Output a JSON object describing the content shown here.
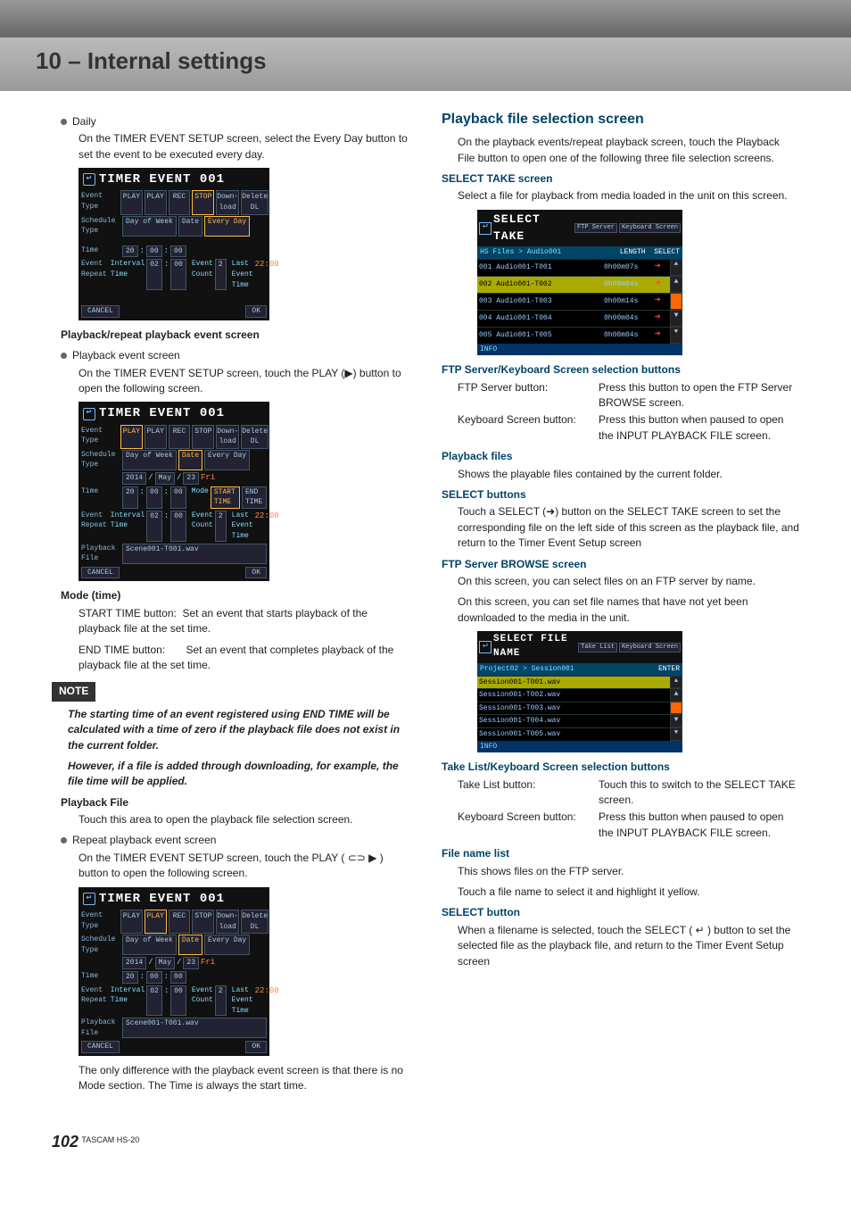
{
  "page": {
    "number": "102",
    "model": "TASCAM HS-20"
  },
  "title": "10 – Internal settings",
  "left": {
    "daily": {
      "label": "Daily",
      "body": "On the TIMER EVENT SETUP screen, select the Every Day button to set the event to be executed every day."
    },
    "playback_head": "Playback/repeat playback event screen",
    "playback_event": {
      "label": "Playback event screen",
      "body": "On the TIMER EVENT SETUP screen, touch the PLAY (▶) button to open the following screen."
    },
    "mode_time": {
      "title": "Mode (time)",
      "row1a": "START TIME button:",
      "row1b": "Set an event that starts playback of the playback file at the set time.",
      "row2a": "END TIME button:",
      "row2b": "Set an event that completes playback of the playback file at the set time."
    },
    "note": {
      "label": "NOTE",
      "p1": "The starting time of an event registered using END TIME will be calculated with a time of zero if the playback file does not exist in the current folder.",
      "p2": "However, if a file is added through downloading, for example, the file time will be applied."
    },
    "playback_file": {
      "title": "Playback File",
      "body": "Touch this area to open the playback file selection screen."
    },
    "repeat": {
      "label": "Repeat playback event screen",
      "body1": "On the TIMER EVENT SETUP screen, touch the PLAY ( ⊂⊃ ▶ ) button to open the following screen.",
      "body2": "The only difference with the playback event screen is that there is no Mode section. The Time is always the start time."
    },
    "timer_screen": {
      "title": "TIMER EVENT 001",
      "labels": {
        "event_type": "Event Type",
        "schedule_type": "Schedule Type",
        "time": "Time",
        "event_repeat": "Event Repeat",
        "playback_file": "Playback File"
      },
      "evtypes": [
        "PLAY",
        "PLAY",
        "REC",
        "STOP",
        "Down-load",
        "Delete DL"
      ],
      "sched": {
        "dow": "Day of Week",
        "date": "Date",
        "every": "Every Day"
      },
      "dateparts": [
        "2014",
        "/",
        "May",
        "/",
        "23",
        "Fri"
      ],
      "time_parts": [
        "20",
        ":",
        "00",
        ":",
        "00"
      ],
      "mode": [
        "Mode",
        "START TIME",
        "END TIME"
      ],
      "interval": {
        "label": "Interval Time",
        "h": "02",
        "m": "00"
      },
      "event_count": {
        "label": "Event Count",
        "val": "2"
      },
      "last": {
        "label": "Last Event Time",
        "val": "22:00"
      },
      "file": "Scene001-T001.wav",
      "cancel": "CANCEL",
      "ok": "OK"
    }
  },
  "right": {
    "h2": "Playback file selection screen",
    "intro": "On the playback events/repeat playback screen, touch the Playback File button to open one of the following three file selection screens.",
    "select_take": {
      "title": "SELECT TAKE screen",
      "body": "Select a file for playback from media loaded in the unit on this screen.",
      "screen": {
        "title": "SELECT TAKE",
        "hb1": "FTP Server",
        "hb2": "Keyboard Screen",
        "path": "HS Files > Audio001",
        "cols": {
          "len": "LENGTH",
          "sel": "SELECT"
        },
        "rows": [
          {
            "n": "001",
            "name": "Audio001-T001",
            "len": "0h00m07s"
          },
          {
            "n": "002",
            "name": "Audio001-T002",
            "len": "0h00m04s"
          },
          {
            "n": "003",
            "name": "Audio001-T003",
            "len": "0h00m14s"
          },
          {
            "n": "004",
            "name": "Audio001-T004",
            "len": "0h00m04s"
          },
          {
            "n": "005",
            "name": "Audio001-T005",
            "len": "0h00m04s"
          }
        ],
        "info": "INFO"
      }
    },
    "ftp_kb": {
      "title": "FTP Server/Keyboard Screen selection buttons",
      "row1k": "FTP Server button:",
      "row1v": "Press this button to open the FTP Server BROWSE screen.",
      "row2k": "Keyboard Screen button:",
      "row2v": "Press this button when paused to open the INPUT PLAYBACK FILE screen."
    },
    "playback_files": {
      "title": "Playback files",
      "body": "Shows the playable files contained by the current folder."
    },
    "select_buttons": {
      "title": "SELECT buttons",
      "body": "Touch a SELECT (➜) button on the  SELECT TAKE screen to set the corresponding file on the left side of this screen as the playback file, and return to the Timer Event Setup screen"
    },
    "browse": {
      "title": "FTP Server BROWSE screen",
      "p1": "On this screen, you can select files on an FTP server by name.",
      "p2": "On this screen, you can set file names that have not yet been downloaded to the media in the unit.",
      "screen": {
        "title": "SELECT FILE NAME",
        "hb1": "Take List",
        "hb2": "Keyboard Screen",
        "path": "Project02 > Session001",
        "enter": "ENTER",
        "rows": [
          "Session001-T001.wav",
          "Session001-T002.wav",
          "Session001-T003.wav",
          "Session001-T004.wav",
          "Session001-T005.wav"
        ],
        "info": "INFO"
      }
    },
    "take_kb": {
      "title": "Take List/Keyboard Screen selection buttons",
      "row1k": "Take List button:",
      "row1v": "Touch this to switch to the SELECT TAKE screen.",
      "row2k": "Keyboard Screen button:",
      "row2v": "Press this button when paused to open the INPUT PLAYBACK FILE screen."
    },
    "file_list": {
      "title": "File name list",
      "p1": "This shows files on the FTP server.",
      "p2": "Touch a file name to select it and highlight it yellow."
    },
    "select_button": {
      "title": "SELECT button",
      "body": "When a filename is selected, touch the SELECT ( ↵ ) button to set the selected file as the playback file, and return to the Timer Event Setup screen"
    }
  }
}
